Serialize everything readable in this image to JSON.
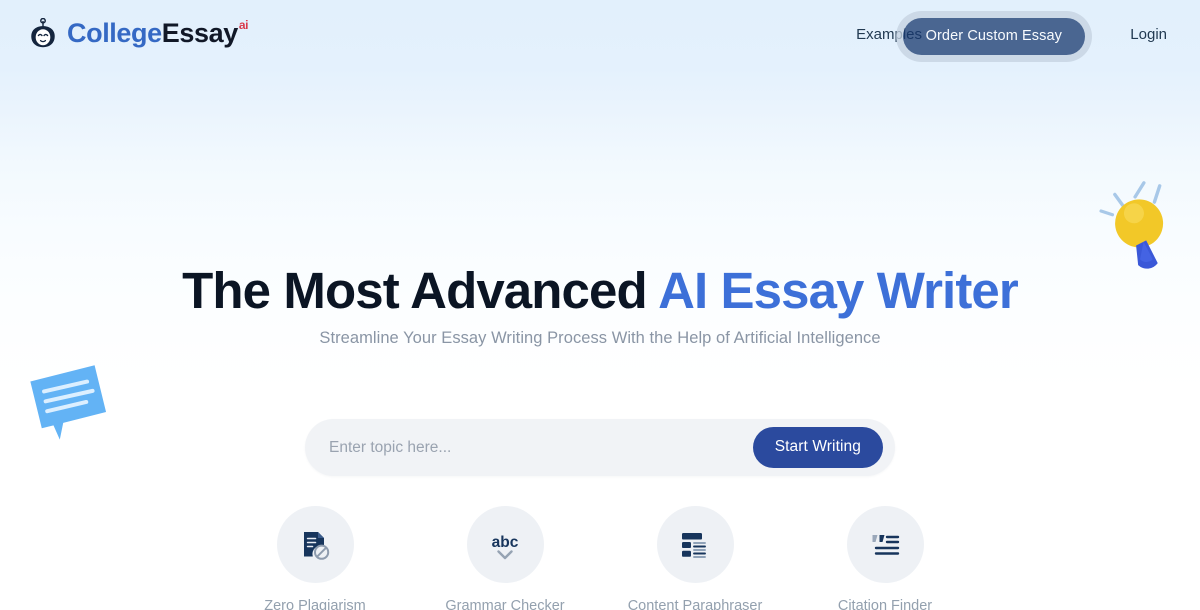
{
  "header": {
    "logo": {
      "icon": "robot-head-icon",
      "part1": "College",
      "part2": "Essay",
      "superscript": "ai"
    },
    "nav": {
      "examples": "Examples",
      "order_cta": "Order Custom Essay",
      "login": "Login"
    }
  },
  "hero": {
    "title_dark": "The Most Advanced ",
    "title_blue": "AI Essay Writer",
    "subtitle": "Streamline Your Essay Writing Process With the Help of Artificial Intelligence"
  },
  "search": {
    "placeholder": "Enter topic here...",
    "value": "",
    "submit_label": "Start Writing"
  },
  "features": [
    {
      "label": "Zero Plagiarism",
      "icon": "document-blocked-icon"
    },
    {
      "label": "Grammar Checker",
      "icon": "abc-check-icon"
    },
    {
      "label": "Content Paraphraser",
      "icon": "layout-blocks-icon"
    },
    {
      "label": "Citation Finder",
      "icon": "quote-lines-icon"
    }
  ],
  "decorations": {
    "lightbulb": "lightbulb-icon",
    "speech_bubble": "speech-bubble-icon"
  },
  "colors": {
    "brand_blue": "#3569c4",
    "accent_red": "#d93a4b",
    "cta_navy": "#17386e",
    "button_blue": "#2b4a9e",
    "title_blue": "#3d70d8",
    "title_dark": "#0b1524",
    "muted_text": "#93a0ae",
    "bg_top": "#e2f0fc",
    "bg_bottom": "#ffffff",
    "icon_navy": "#17355c",
    "bulb_yellow": "#f2c828",
    "bulb_blue": "#3a58d8"
  }
}
